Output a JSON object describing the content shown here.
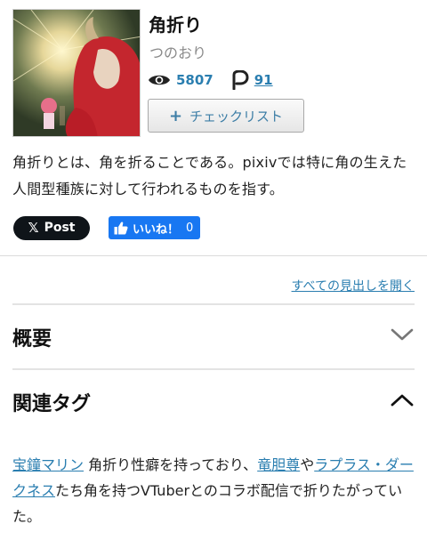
{
  "article": {
    "title": "角折り",
    "reading": "つのおり",
    "views": "5807",
    "pixpedia_count": "91",
    "checklist_label": "チェックリスト",
    "summary": "角折りとは、角を折ることである。pixivでは特に角の生えた人間型種族に対して行われるものを指す。"
  },
  "share": {
    "x_post_label": "Post",
    "like_label": "いいね！",
    "like_count": "0"
  },
  "toc": {
    "open_all_label": "すべての見出しを開く"
  },
  "sections": {
    "overview_title": "概要",
    "related_title": "関連タグ"
  },
  "related": {
    "link1": "宝鐘マリン",
    "text1": " 角折り性癖を持っており、",
    "link2": "竜胆尊",
    "text2": "や",
    "link3": "ラプラス・ダークネス",
    "text3": "たち角を持つVTuberとのコラボ配信で折りたがっていた。"
  },
  "icons": {
    "views": "eye-icon",
    "pixpedia": "pixpedia-p-icon",
    "checklist": "plus-icon",
    "x": "x-logo-icon",
    "like": "thumbs-up-icon",
    "overview_toggle": "chevron-down-icon",
    "related_toggle": "chevron-up-icon"
  },
  "colors": {
    "link": "#2a7eb0",
    "like_bg": "#1877f2",
    "x_bg": "#0f1419"
  }
}
